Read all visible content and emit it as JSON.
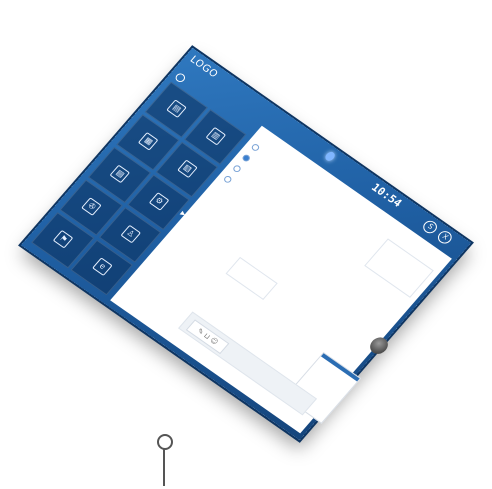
{
  "header": {
    "logo": "LOGO",
    "time": "10:54",
    "date": "",
    "icon_left": "S",
    "icon_right": "X"
  },
  "user": {
    "name": ""
  },
  "tiles": [
    {
      "label": "",
      "icon": "copy-icon",
      "glyph": "▤"
    },
    {
      "label": "",
      "icon": "print-icon",
      "glyph": "▥"
    },
    {
      "label": "",
      "icon": "scan-icon",
      "glyph": "▦"
    },
    {
      "label": "",
      "icon": "fax-icon",
      "glyph": "▧"
    },
    {
      "label": "",
      "icon": "document-icon",
      "glyph": "▨"
    },
    {
      "label": "",
      "icon": "settings-icon",
      "glyph": "⚙"
    },
    {
      "label": "",
      "icon": "film-icon",
      "glyph": "✇"
    },
    {
      "label": "",
      "icon": "person-icon",
      "glyph": "♙"
    },
    {
      "label": "",
      "icon": "flag-icon",
      "glyph": "⚑"
    },
    {
      "label": "",
      "icon": "browser-icon",
      "glyph": "e"
    }
  ],
  "window": {
    "title": "",
    "radios": [
      {
        "label": "",
        "selected": false
      },
      {
        "label": "",
        "selected": true
      },
      {
        "label": "",
        "selected": false
      },
      {
        "label": "",
        "selected": false
      }
    ],
    "right_panel": "",
    "mid_card": "",
    "input_glyph": "✎  ⊔  ☺",
    "side_card_head": "",
    "side_card_body": ""
  },
  "colors": {
    "accent": "#2b6db3",
    "frame": "#1f5fa3"
  }
}
